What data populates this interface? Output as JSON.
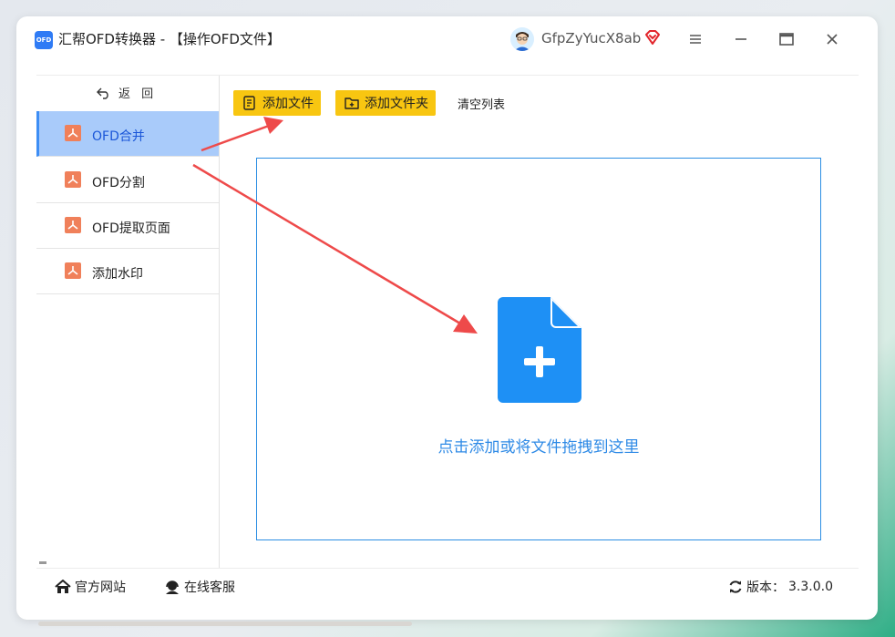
{
  "app": {
    "logo_text": "OFD",
    "title": "汇帮OFD转换器 - 【操作OFD文件】",
    "username": "GfpZyYucX8ab"
  },
  "sidebar": {
    "back_label": "返 回",
    "items": [
      {
        "label": "OFD合并",
        "icon": "ofd-doc-icon",
        "active": true
      },
      {
        "label": "OFD分割",
        "icon": "ofd-doc-icon",
        "active": false
      },
      {
        "label": "OFD提取页面",
        "icon": "ofd-doc-icon",
        "active": false
      },
      {
        "label": "添加水印",
        "icon": "ofd-doc-icon",
        "active": false
      }
    ]
  },
  "toolbar": {
    "add_file_label": "添加文件",
    "add_folder_label": "添加文件夹",
    "clear_list_label": "清空列表"
  },
  "dropzone": {
    "hint": "点击添加或将文件拖拽到这里"
  },
  "statusbar": {
    "website_label": "官方网站",
    "support_label": "在线客服",
    "version_label": "版本：",
    "version_value": "3.3.0.0"
  },
  "colors": {
    "accent_blue": "#2e8ae6",
    "button_yellow": "#f8c611",
    "active_nav_bg": "#a9cbfa",
    "doc_icon_orange": "#f0805a",
    "annotation_red": "#ee4a4a"
  }
}
